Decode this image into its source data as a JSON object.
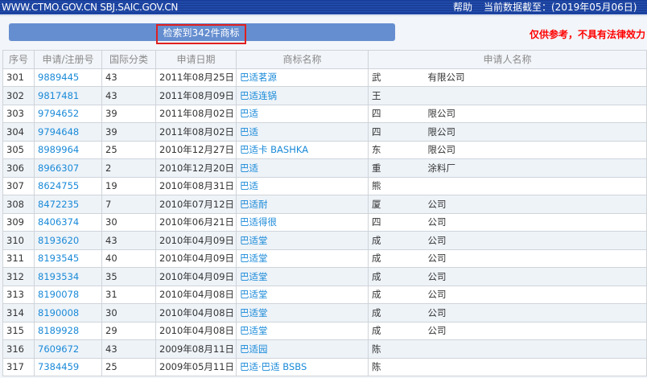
{
  "topbar": {
    "site": "WWW.CTMO.GOV.CN SBJ.SAIC.GOV.CN",
    "help": "帮助",
    "data_date": "当前数据截至：(2019年05月06日)"
  },
  "summary": {
    "count_text": "检索到342件商标",
    "disclaimer": "仅供参考，不具有法律效力"
  },
  "columns": [
    "序号",
    "申请/注册号",
    "国际分类",
    "申请日期",
    "商标名称",
    "申请人名称"
  ],
  "rows": [
    {
      "no": "301",
      "reg": "9889445",
      "cls": "43",
      "date": "2011年08月25日",
      "name": "巴适茗源",
      "app1": "武",
      "app2": "有限公司"
    },
    {
      "no": "302",
      "reg": "9817481",
      "cls": "43",
      "date": "2011年08月09日",
      "name": "巴适连锅",
      "app1": "王",
      "app2": ""
    },
    {
      "no": "303",
      "reg": "9794652",
      "cls": "39",
      "date": "2011年08月02日",
      "name": "巴适",
      "app1": "四",
      "app2": "限公司"
    },
    {
      "no": "304",
      "reg": "9794648",
      "cls": "39",
      "date": "2011年08月02日",
      "name": "巴适",
      "app1": "四",
      "app2": "限公司"
    },
    {
      "no": "305",
      "reg": "8989964",
      "cls": "25",
      "date": "2010年12月27日",
      "name": "巴适卡 BASHKA",
      "app1": "东",
      "app2": "限公司"
    },
    {
      "no": "306",
      "reg": "8966307",
      "cls": "2",
      "date": "2010年12月20日",
      "name": "巴适",
      "app1": "重",
      "app2": "涂料厂"
    },
    {
      "no": "307",
      "reg": "8624755",
      "cls": "19",
      "date": "2010年08月31日",
      "name": "巴适",
      "app1": "熊",
      "app2": ""
    },
    {
      "no": "308",
      "reg": "8472235",
      "cls": "7",
      "date": "2010年07月12日",
      "name": "巴适耐",
      "app1": "厦",
      "app2": "公司"
    },
    {
      "no": "309",
      "reg": "8406374",
      "cls": "30",
      "date": "2010年06月21日",
      "name": "巴适得很",
      "app1": "四",
      "app2": "公司"
    },
    {
      "no": "310",
      "reg": "8193620",
      "cls": "43",
      "date": "2010年04月09日",
      "name": "巴适堂",
      "app1": "成",
      "app2": "公司"
    },
    {
      "no": "311",
      "reg": "8193545",
      "cls": "40",
      "date": "2010年04月09日",
      "name": "巴适堂",
      "app1": "成",
      "app2": "公司"
    },
    {
      "no": "312",
      "reg": "8193534",
      "cls": "35",
      "date": "2010年04月09日",
      "name": "巴适堂",
      "app1": "成",
      "app2": "公司"
    },
    {
      "no": "313",
      "reg": "8190078",
      "cls": "31",
      "date": "2010年04月08日",
      "name": "巴适堂",
      "app1": "成",
      "app2": "公司"
    },
    {
      "no": "314",
      "reg": "8190008",
      "cls": "30",
      "date": "2010年04月08日",
      "name": "巴适堂",
      "app1": "成",
      "app2": "公司"
    },
    {
      "no": "315",
      "reg": "8189928",
      "cls": "29",
      "date": "2010年04月08日",
      "name": "巴适堂",
      "app1": "成",
      "app2": "公司"
    },
    {
      "no": "316",
      "reg": "7609672",
      "cls": "43",
      "date": "2009年08月11日",
      "name": "巴适园",
      "app1": "陈",
      "app2": ""
    },
    {
      "no": "317",
      "reg": "7384459",
      "cls": "25",
      "date": "2009年05月11日",
      "name": "巴适·巴适 BSBS",
      "app1": "陈",
      "app2": ""
    }
  ]
}
